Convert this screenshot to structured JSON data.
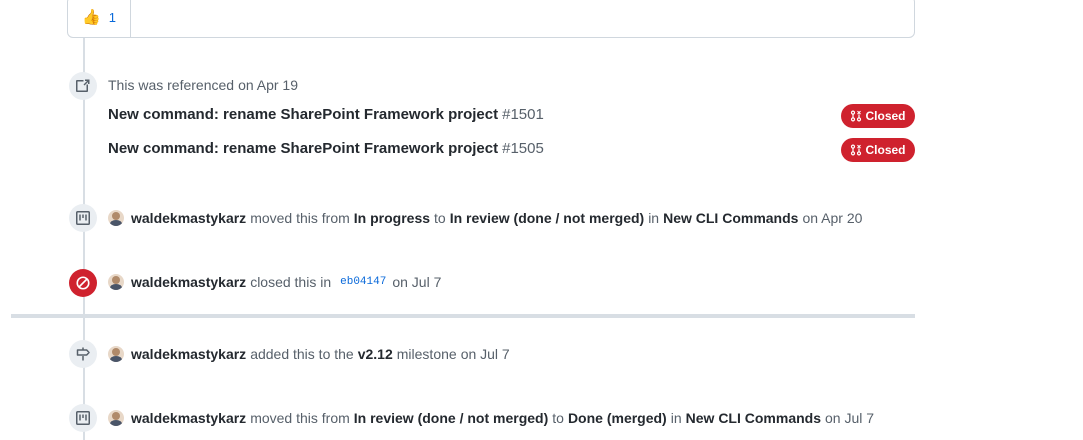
{
  "reaction": {
    "emoji": "👍",
    "count": "1"
  },
  "reference": {
    "header_text": "This was referenced",
    "header_date": "on Apr 19",
    "items": [
      {
        "title": "New command: rename SharePoint Framework project",
        "number": "#1501",
        "state": "Closed"
      },
      {
        "title": "New command: rename SharePoint Framework project",
        "number": "#1505",
        "state": "Closed"
      }
    ]
  },
  "events": {
    "moved1": {
      "author": "waldekmastykarz",
      "t1": "moved this from",
      "from": "In progress",
      "t2": "to",
      "to": "In review (done / not merged)",
      "t3": "in",
      "project": "New CLI Commands",
      "date": "on Apr 20"
    },
    "closed": {
      "author": "waldekmastykarz",
      "t1": "closed this in",
      "commit": "eb04147",
      "date": "on Jul 7"
    },
    "milestone": {
      "author": "waldekmastykarz",
      "t1": "added this to the",
      "milestone": "v2.12",
      "t2": "milestone",
      "date": "on Jul 7"
    },
    "moved2": {
      "author": "waldekmastykarz",
      "t1": "moved this from",
      "from": "In review (done / not merged)",
      "t2": "to",
      "to": "Done (merged)",
      "t3": "in",
      "project": "New CLI Commands",
      "date": "on Jul 7"
    }
  },
  "colors": {
    "closed_red": "#cf222e",
    "link_blue": "#0969da",
    "badge_gray": "#eaeef2",
    "timeline_gray": "#d8dee4"
  },
  "icons": [
    "thumbs-up-icon",
    "cross-reference-icon",
    "git-pull-request-closed-icon",
    "project-icon",
    "circle-slash-icon",
    "milestone-icon",
    "avatar"
  ]
}
